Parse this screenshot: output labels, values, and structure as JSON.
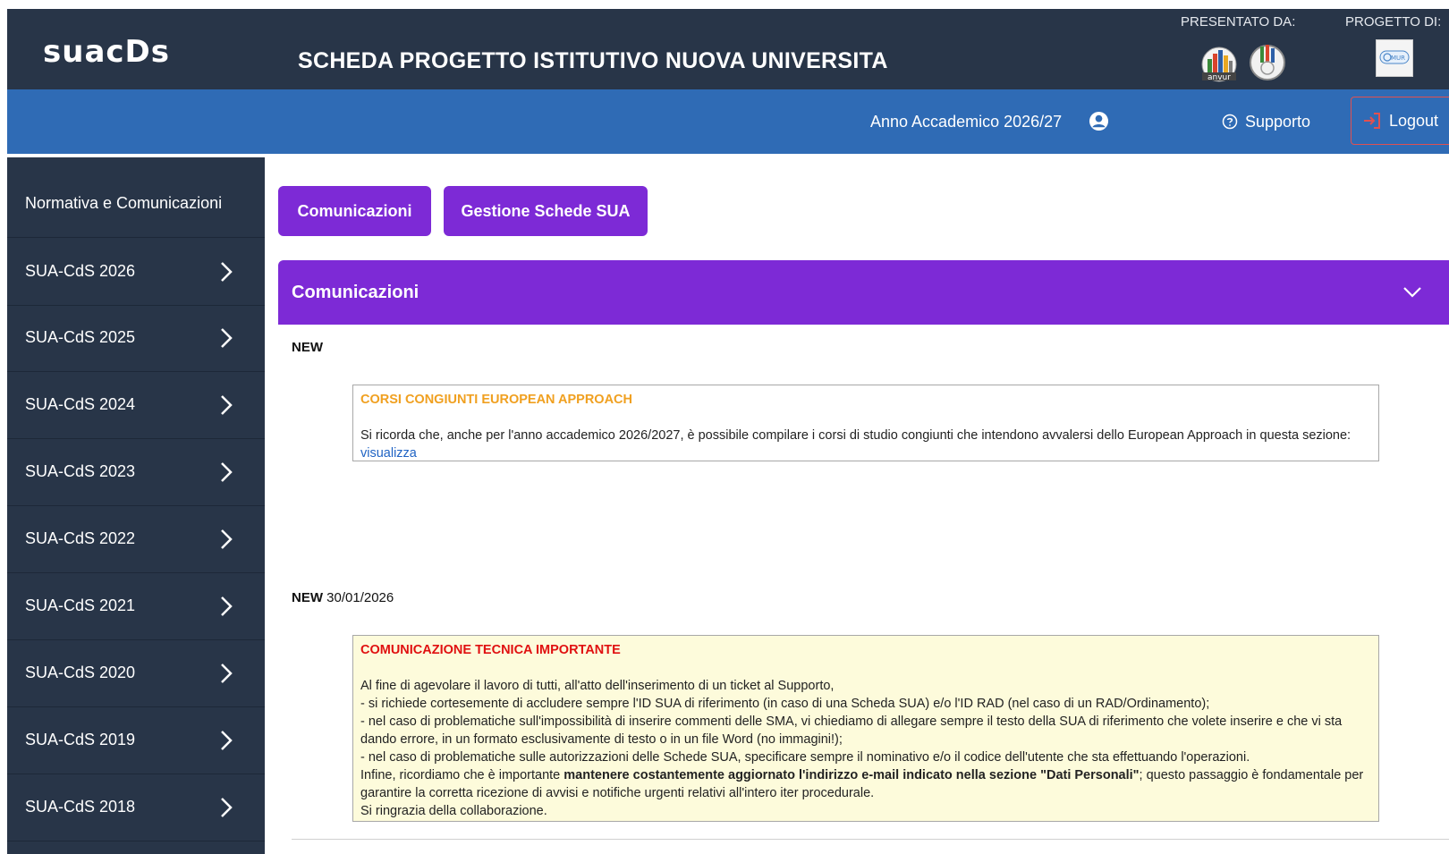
{
  "header": {
    "logo_text": "suacDs",
    "title": "SCHEDA PROGETTO ISTITUTIVO NUOVA UNIVERSITA",
    "presented_by_label": "PRESENTATO DA:",
    "project_of_label": "PROGETTO DI:",
    "presenter_logos": [
      "anvur",
      "cnvsu"
    ]
  },
  "subbar": {
    "academic_year": "Anno Accademico 2026/27",
    "support_label": "Supporto",
    "logout_label": "Logout"
  },
  "sidebar": {
    "items": [
      {
        "label": "Normativa e Comunicazioni"
      },
      {
        "label": "SUA-CdS 2026"
      },
      {
        "label": "SUA-CdS 2025"
      },
      {
        "label": "SUA-CdS 2024"
      },
      {
        "label": "SUA-CdS 2023"
      },
      {
        "label": "SUA-CdS 2022"
      },
      {
        "label": "SUA-CdS 2021"
      },
      {
        "label": "SUA-CdS 2020"
      },
      {
        "label": "SUA-CdS 2019"
      },
      {
        "label": "SUA-CdS 2018"
      }
    ]
  },
  "tabs": {
    "communications": "Comunicazioni",
    "manage_sheets": "Gestione Schede SUA"
  },
  "section": {
    "title": "Comunicazioni"
  },
  "news": [
    {
      "tag": "NEW",
      "date": "",
      "title": "CORSI CONGIUNTI EUROPEAN APPROACH",
      "body": "Si ricorda che, anche per l'anno accademico 2026/2027, è possibile compilare i corsi di studio congiunti che intendono avvalersi dello European Approach in questa sezione: ",
      "link": "visualizza"
    },
    {
      "tag": "NEW",
      "date": "30/01/2026",
      "title": "COMUNICAZIONE TECNICA IMPORTANTE",
      "line1": "Al fine di agevolare il lavoro di tutti, all'atto dell'inserimento di un ticket al Supporto,",
      "line2": "- si richiede cortesemente di accludere sempre l'ID SUA di riferimento (in caso di una Scheda SUA) e/o l'ID RAD (nel caso di un RAD/Ordinamento);",
      "line3": "- nel caso di problematiche sull'impossibilità di inserire commenti delle SMA, vi chiediamo di allegare sempre il testo della SUA di riferimento che volete inserire e che vi sta dando errore, in un formato esclusivamente di testo o in un file Word (no immagini!);",
      "line4": "- nel caso di problematiche sulle autorizzazioni delle Schede SUA, specificare sempre il nominativo e/o il codice dell'utente che sta effettuando l'operazioni.",
      "line5_pre": "Infine, ricordiamo che è importante ",
      "line5_bold": "mantenere costantemente aggiornato l'indirizzo e-mail indicato nella sezione \"Dati Personali\"",
      "line5_post": "; questo passaggio è fondamentale per garantire la corretta ricezione di avvisi e notifiche urgenti relativi all'intero iter procedurale.",
      "line6": "Si ringrazia della collaborazione."
    }
  ],
  "colors": {
    "header_bg": "#283548",
    "subbar_bg": "#2f6bb5",
    "accent_purple": "#7d2ad6",
    "title_orange": "#f0a020",
    "title_red": "#e01010",
    "notice_bg": "#fdfbdb"
  }
}
